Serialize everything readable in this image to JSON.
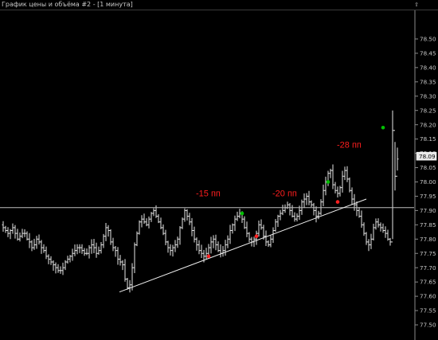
{
  "window": {
    "title": "График цены и объёма #2 - [1 минута]",
    "scroll_glyph": "⇧"
  },
  "chart_data": {
    "type": "ohlc",
    "title": "График цены и объёма #2 - [1 минута]",
    "timeframe": "1 минута",
    "ylim": [
      77.5,
      78.55
    ],
    "y_ticks": [
      "78.50",
      "78.45",
      "78.40",
      "78.35",
      "78.30",
      "78.25",
      "78.20",
      "78.15",
      "78.10",
      "78.05",
      "78.00",
      "77.95",
      "77.90",
      "77.85",
      "77.80",
      "77.75",
      "77.70",
      "77.65",
      "77.60",
      "77.55",
      "77.50"
    ],
    "grid": false,
    "current_price": "78.09",
    "horizontal_level": 77.91,
    "trendline": {
      "from": [
        0,
        77.615
      ],
      "to": [
        152,
        77.94
      ]
    },
    "closes": [
      77.84,
      77.83,
      77.82,
      77.83,
      77.84,
      77.82,
      77.8,
      77.81,
      77.82,
      77.82,
      77.8,
      77.79,
      77.77,
      77.78,
      77.8,
      77.79,
      77.77,
      77.76,
      77.74,
      77.73,
      77.72,
      77.71,
      77.7,
      77.69,
      77.69,
      77.7,
      77.72,
      77.73,
      77.74,
      77.75,
      77.76,
      77.77,
      77.77,
      77.76,
      77.75,
      77.75,
      77.77,
      77.78,
      77.77,
      77.75,
      77.76,
      77.78,
      77.81,
      77.84,
      77.83,
      77.79,
      77.77,
      77.76,
      77.73,
      77.72,
      77.71,
      77.66,
      77.63,
      77.64,
      77.7,
      77.78,
      77.82,
      77.86,
      77.87,
      77.86,
      77.85,
      77.87,
      77.89,
      77.9,
      77.88,
      77.86,
      77.84,
      77.82,
      77.79,
      77.77,
      77.76,
      77.77,
      77.78,
      77.8,
      77.84,
      77.87,
      77.9,
      77.88,
      77.86,
      77.83,
      77.8,
      77.78,
      77.76,
      77.75,
      77.74,
      77.75,
      77.77,
      77.79,
      77.8,
      77.78,
      77.76,
      77.75,
      77.76,
      77.78,
      77.8,
      77.83,
      77.85,
      77.87,
      77.88,
      77.89,
      77.87,
      77.84,
      77.82,
      77.8,
      77.79,
      77.8,
      77.82,
      77.85,
      77.84,
      77.81,
      77.79,
      77.78,
      77.8,
      77.83,
      77.86,
      77.88,
      77.89,
      77.9,
      77.91,
      77.92,
      77.9,
      77.88,
      77.87,
      77.88,
      77.9,
      77.93,
      77.94,
      77.95,
      77.93,
      77.92,
      77.9,
      77.88,
      77.89,
      77.93,
      77.97,
      78.0,
      78.03,
      78.04,
      77.99,
      77.97,
      77.96,
      77.98,
      78.02,
      78.04,
      78.01,
      77.97,
      77.94,
      77.92,
      77.9,
      77.88,
      77.85,
      77.82,
      77.79,
      77.78,
      77.8,
      77.84,
      77.86,
      77.85,
      77.84,
      77.83,
      77.82,
      77.8,
      77.79,
      78.18,
      78.02,
      78.08
    ],
    "markers": [
      {
        "index": 86,
        "price": 77.74,
        "color": "#ff2020"
      },
      {
        "index": 100,
        "price": 77.89,
        "color": "#00c000"
      },
      {
        "index": 106,
        "price": 77.81,
        "color": "#ff2020"
      },
      {
        "index": 136,
        "price": 78.0,
        "color": "#00c000"
      },
      {
        "index": 140,
        "price": 77.93,
        "color": "#ff2020"
      },
      {
        "index": 159,
        "price": 78.19,
        "color": "#00c000"
      }
    ],
    "annotations": [
      {
        "text": "-15 пп",
        "index": 84,
        "price": 77.95
      },
      {
        "text": "-20 пп",
        "index": 116,
        "price": 77.95
      },
      {
        "text": "-28 пп",
        "index": 143,
        "price": 78.12
      }
    ],
    "colors": {
      "background": "#000000",
      "bars": "#e6e6e6",
      "text": "#c8c8c8",
      "annotation": "#ff1e1e",
      "level": "#bdbdbd",
      "trendline": "#f0f0f0"
    }
  }
}
